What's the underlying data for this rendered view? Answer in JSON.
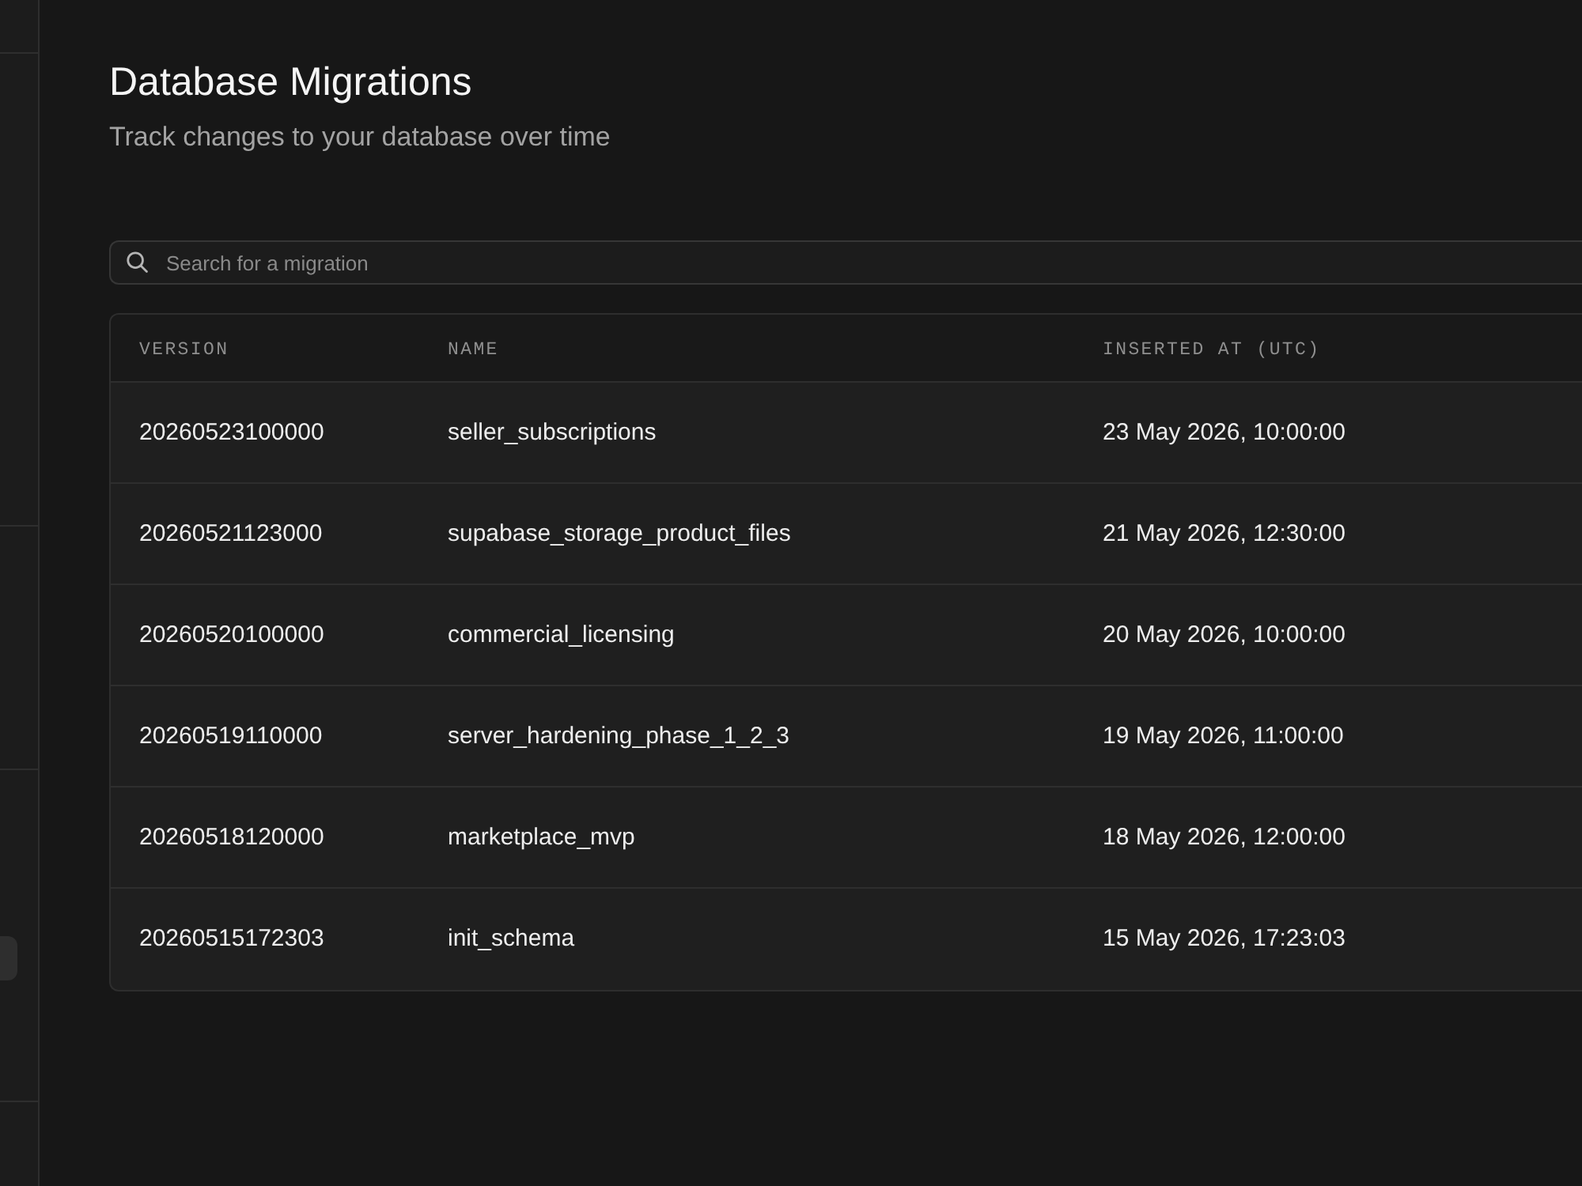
{
  "page": {
    "title": "Database Migrations",
    "subtitle": "Track changes to your database over time"
  },
  "search": {
    "placeholder": "Search for a migration"
  },
  "table": {
    "columns": [
      "VERSION",
      "NAME",
      "INSERTED AT (UTC)"
    ],
    "rows": [
      [
        "20260523100000",
        "seller_subscriptions",
        "23 May 2026, 10:00:00"
      ],
      [
        "20260521123000",
        "supabase_storage_product_files",
        "21 May 2026, 12:30:00"
      ],
      [
        "20260520100000",
        "commercial_licensing",
        "20 May 2026, 10:00:00"
      ],
      [
        "20260519110000",
        "server_hardening_phase_1_2_3",
        "19 May 2026, 11:00:00"
      ],
      [
        "20260518120000",
        "marketplace_mvp",
        "18 May 2026, 12:00:00"
      ],
      [
        "20260515172303",
        "init_schema",
        "15 May 2026, 17:23:03"
      ]
    ]
  }
}
